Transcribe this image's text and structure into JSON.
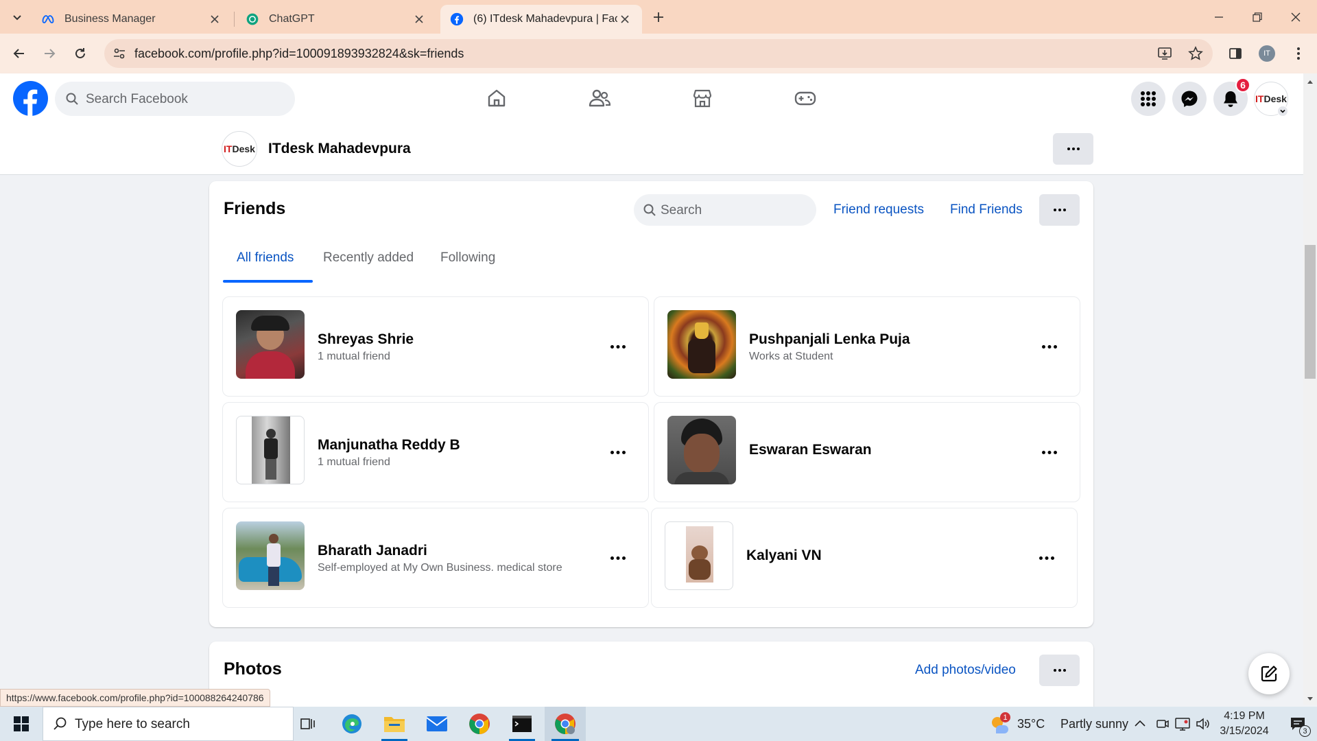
{
  "browser": {
    "tabs": [
      {
        "title": "Business Manager",
        "icon": "meta-icon"
      },
      {
        "title": "ChatGPT",
        "icon": "chatgpt-icon"
      },
      {
        "title": "(6) ITdesk Mahadevpura | Faceb",
        "icon": "facebook-icon"
      }
    ],
    "url": "facebook.com/profile.php?id=100091893932824&sk=friends",
    "profile_initials": "IT"
  },
  "facebook": {
    "search_placeholder": "Search Facebook",
    "notification_count": "6",
    "profile_name": "ITdesk Mahadevpura",
    "logo_text_it": "IT",
    "logo_text_desk": "Desk"
  },
  "friends": {
    "title": "Friends",
    "search_placeholder": "Search",
    "friend_requests_label": "Friend requests",
    "find_friends_label": "Find Friends",
    "tabs": [
      "All friends",
      "Recently added",
      "Following"
    ],
    "active_tab": "All friends",
    "list": [
      {
        "name": "Shreyas Shrie",
        "subtitle": "1 mutual friend"
      },
      {
        "name": "Pushpanjali Lenka Puja",
        "subtitle": "Works at Student"
      },
      {
        "name": "Manjunatha Reddy B",
        "subtitle": "1 mutual friend"
      },
      {
        "name": "Eswaran Eswaran",
        "subtitle": ""
      },
      {
        "name": "Bharath Janadri",
        "subtitle": "Self-employed at My Own Business. medical store"
      },
      {
        "name": "Kalyani VN",
        "subtitle": ""
      }
    ]
  },
  "photos": {
    "title": "Photos",
    "add_label": "Add photos/video"
  },
  "status_url": "https://www.facebook.com/profile.php?id=100088264240786",
  "taskbar": {
    "search_placeholder": "Type here to search",
    "weather_temp": "35°C",
    "weather_text": "Partly sunny",
    "weather_badge": "1",
    "time": "4:19 PM",
    "date": "3/15/2024",
    "notification_count": "3"
  },
  "colors": {
    "facebook_blue": "#0866ff",
    "link_blue": "#0a54c2",
    "tab_strip": "#f9d7c2",
    "toolbar": "#fbebe1",
    "notification_red": "#e41e3f"
  }
}
